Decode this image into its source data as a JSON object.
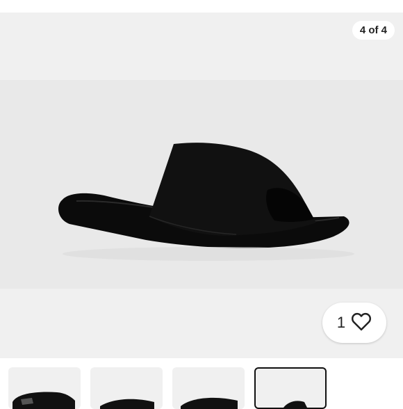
{
  "gallery": {
    "counter": "4 of 4",
    "like_count": "1",
    "thumbnails": [
      {
        "selected": false
      },
      {
        "selected": false
      },
      {
        "selected": false
      },
      {
        "selected": true
      }
    ]
  },
  "colors": {
    "product": "#0c0c0c",
    "background": "#f0f0f0"
  }
}
